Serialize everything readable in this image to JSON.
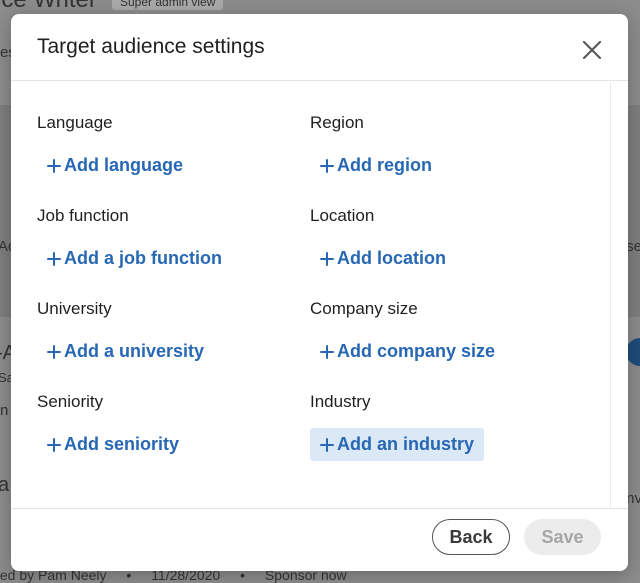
{
  "background": {
    "header_title": "ice Writer",
    "header_badge": "Super admin view",
    "left_fragments": [
      "es",
      "Ad",
      "-A",
      "Sa",
      "n",
      "a"
    ],
    "right_fragments": [
      "se",
      "nv"
    ],
    "footer_meta": {
      "author": "ted by Pam Neely",
      "date": "11/28/2020",
      "sponsor": "Sponsor now"
    }
  },
  "modal": {
    "title": "Target audience settings",
    "fields": [
      {
        "label": "Language",
        "action": "Add language"
      },
      {
        "label": "Region",
        "action": "Add region"
      },
      {
        "label": "Job function",
        "action": "Add a job function"
      },
      {
        "label": "Location",
        "action": "Add location"
      },
      {
        "label": "University",
        "action": "Add a university"
      },
      {
        "label": "Company size",
        "action": "Add company size"
      },
      {
        "label": "Seniority",
        "action": "Add seniority"
      },
      {
        "label": "Industry",
        "action": "Add an industry"
      }
    ],
    "footer": {
      "back_label": "Back",
      "save_label": "Save"
    }
  },
  "colors": {
    "link": "#2767b4",
    "link_hover_bg": "#dbe8f6",
    "disabled_bg": "#ececec",
    "disabled_text": "#a6a6a6"
  }
}
